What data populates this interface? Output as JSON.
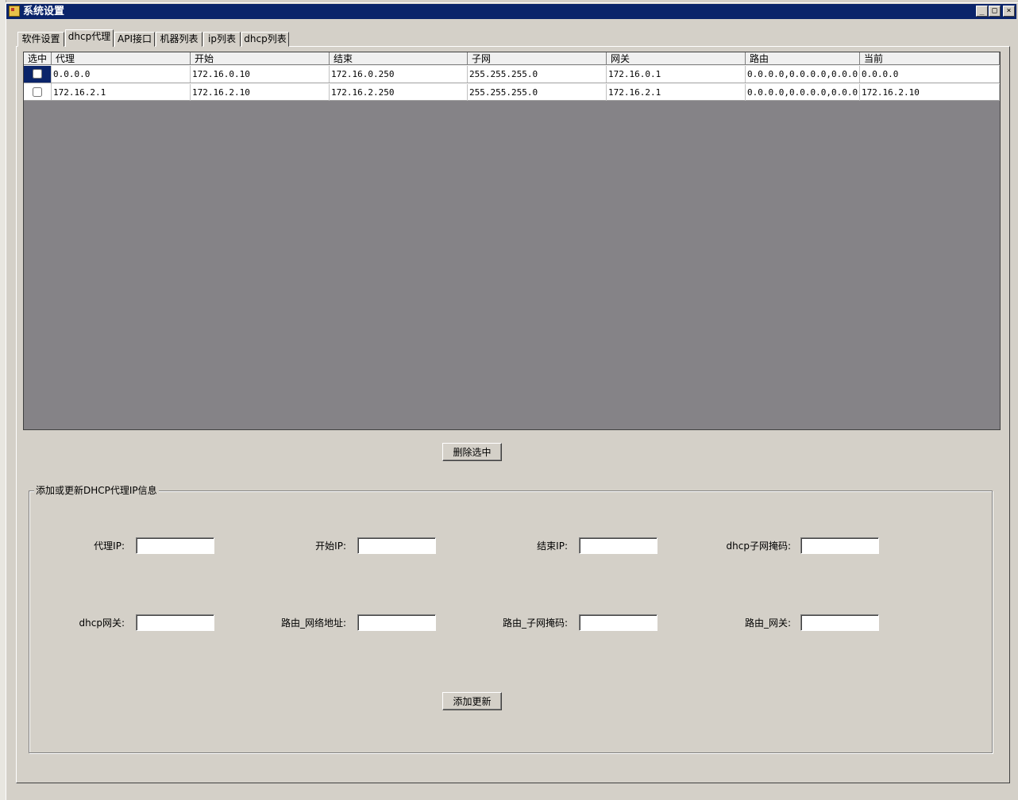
{
  "window": {
    "title": "系统设置"
  },
  "title_controls": {
    "minimize": "_",
    "maximize": "□",
    "close": "×"
  },
  "tabs": [
    "软件设置",
    "dhcp代理",
    "API接口",
    "机器列表",
    "ip列表",
    "dhcp列表"
  ],
  "active_tab": "dhcp代理",
  "grid": {
    "columns": [
      "选中",
      "代理",
      "开始",
      "结束",
      "子网",
      "网关",
      "路由",
      "当前"
    ],
    "rows": [
      {
        "checked": false,
        "proxy": "0.0.0.0",
        "start": "172.16.0.10",
        "end": "172.16.0.250",
        "subnet": "255.255.255.0",
        "gateway": "172.16.0.1",
        "route": "0.0.0.0,0.0.0.0,0.0.0.0",
        "current": "0.0.0.0"
      },
      {
        "checked": false,
        "proxy": "172.16.2.1",
        "start": "172.16.2.10",
        "end": "172.16.2.250",
        "subnet": "255.255.255.0",
        "gateway": "172.16.2.1",
        "route": "0.0.0.0,0.0.0.0,0.0.0.0",
        "current": "172.16.2.10"
      }
    ]
  },
  "delete_button": "删除选中",
  "form": {
    "group_title": "添加或更新DHCP代理IP信息",
    "labels": {
      "proxy_ip": "代理IP:",
      "start_ip": "开始IP:",
      "end_ip": "结束IP:",
      "dhcp_mask": "dhcp子网掩码:",
      "dhcp_gateway": "dhcp网关:",
      "route_network": "路由_网络地址:",
      "route_mask": "路由_子网掩码:",
      "route_gateway": "路由_网关:"
    },
    "values": {
      "proxy_ip": "",
      "start_ip": "",
      "end_ip": "",
      "dhcp_mask": "",
      "dhcp_gateway": "",
      "route_network": "",
      "route_mask": "",
      "route_gateway": ""
    },
    "submit_button": "添加更新"
  }
}
